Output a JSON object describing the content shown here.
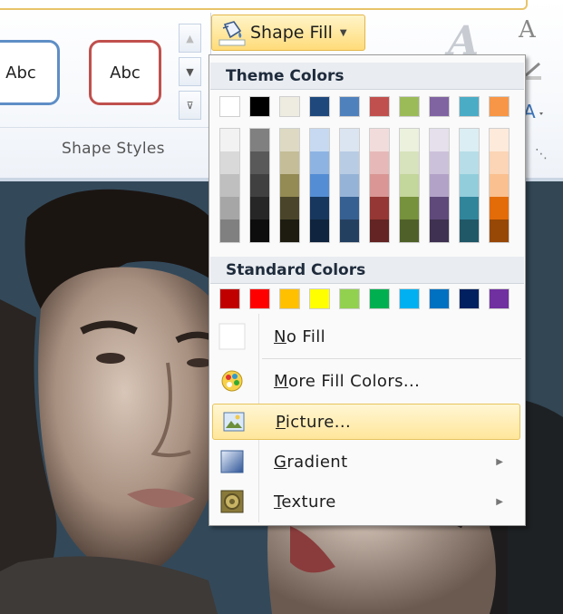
{
  "ribbon": {
    "style_thumbs": [
      "Abc",
      "Abc"
    ],
    "group_label": "Shape Styles",
    "shape_fill_label": "Shape Fill",
    "wordart_glyph": "A",
    "text_fill_glyph": "A"
  },
  "menu": {
    "theme_header": "Theme Colors",
    "standard_header": "Standard Colors",
    "theme_colors": [
      "#ffffff",
      "#000000",
      "#eeece1",
      "#1f497d",
      "#4f81bd",
      "#c0504d",
      "#9bbb59",
      "#8064a2",
      "#4bacc6",
      "#f79646"
    ],
    "theme_shades": [
      [
        "#f2f2f2",
        "#d9d9d9",
        "#bfbfbf",
        "#a6a6a6",
        "#808080"
      ],
      [
        "#808080",
        "#595959",
        "#404040",
        "#262626",
        "#0d0d0d"
      ],
      [
        "#ddd9c3",
        "#c4bd97",
        "#948a54",
        "#4a452a",
        "#1e1c11"
      ],
      [
        "#c6d9f1",
        "#8db3e2",
        "#548dd4",
        "#17375e",
        "#0f243e"
      ],
      [
        "#dbe5f1",
        "#b8cce4",
        "#95b3d7",
        "#366092",
        "#244061"
      ],
      [
        "#f2dcdb",
        "#e6b9b8",
        "#d99694",
        "#953734",
        "#632423"
      ],
      [
        "#ebf1dd",
        "#d7e3bc",
        "#c3d69b",
        "#76923c",
        "#4f6128"
      ],
      [
        "#e5e0ec",
        "#ccc1da",
        "#b2a2c7",
        "#5f497a",
        "#3f3151"
      ],
      [
        "#dbeef3",
        "#b7dde8",
        "#92cddc",
        "#31859b",
        "#205867"
      ],
      [
        "#fdeada",
        "#fbd5b5",
        "#fac08f",
        "#e36c09",
        "#974806"
      ]
    ],
    "standard_colors": [
      "#c00000",
      "#ff0000",
      "#ffc000",
      "#ffff00",
      "#92d050",
      "#00b050",
      "#00b0f0",
      "#0070c0",
      "#002060",
      "#7030a0"
    ],
    "items": [
      {
        "first": "N",
        "rest": "o Fill",
        "icon": "no-fill-icon"
      },
      {
        "first": "M",
        "rest": "ore Fill Colors...",
        "icon": "palette-icon"
      },
      {
        "first": "P",
        "rest": "icture...",
        "icon": "picture-icon"
      },
      {
        "first": "G",
        "rest": "radient",
        "icon": "gradient-icon"
      },
      {
        "first": "T",
        "rest": "exture",
        "icon": "texture-icon"
      }
    ],
    "submenu_arrow": "▶"
  }
}
